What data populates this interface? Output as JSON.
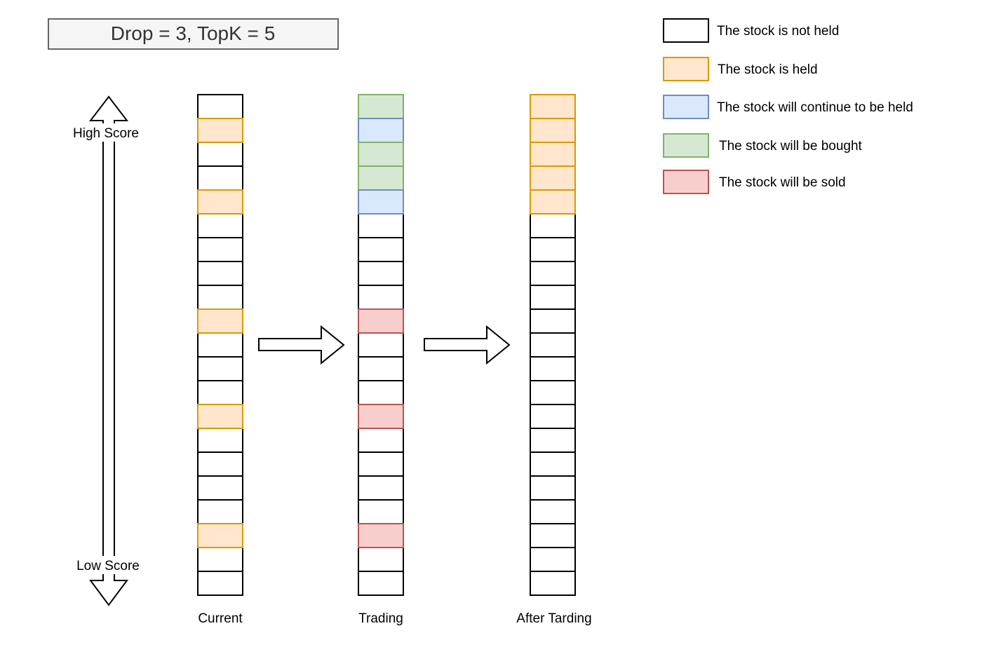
{
  "header": {
    "title": "Drop = 3, TopK = 5"
  },
  "score_axis": {
    "high_label": "High Score",
    "low_label": "Low Score"
  },
  "colors": {
    "empty": {
      "fill": "#ffffff",
      "stroke": "#000000"
    },
    "held": {
      "fill": "#ffe6cc",
      "stroke": "#d79b00"
    },
    "continue": {
      "fill": "#dae8fc",
      "stroke": "#6c8ebf"
    },
    "buy": {
      "fill": "#d5e8d4",
      "stroke": "#82b366"
    },
    "sell": {
      "fill": "#f8cecc",
      "stroke": "#b85450"
    }
  },
  "legend": [
    {
      "state": "empty",
      "label": "The stock is not held"
    },
    {
      "state": "held",
      "label": "The stock is held"
    },
    {
      "state": "continue",
      "label": "The stock will continue to be held"
    },
    {
      "state": "buy",
      "label": "The stock will be bought"
    },
    {
      "state": "sell",
      "label": "The stock will be sold"
    }
  ],
  "columns": [
    {
      "id": "current",
      "label": "Current",
      "cells": [
        "empty",
        "held",
        "empty",
        "empty",
        "held",
        "empty",
        "empty",
        "empty",
        "empty",
        "held",
        "empty",
        "empty",
        "empty",
        "held",
        "empty",
        "empty",
        "empty",
        "empty",
        "held",
        "empty",
        "empty"
      ]
    },
    {
      "id": "trading",
      "label": "Trading",
      "cells": [
        "buy",
        "continue",
        "buy",
        "buy",
        "continue",
        "empty",
        "empty",
        "empty",
        "empty",
        "sell",
        "empty",
        "empty",
        "empty",
        "sell",
        "empty",
        "empty",
        "empty",
        "empty",
        "sell",
        "empty",
        "empty"
      ]
    },
    {
      "id": "after-trading",
      "label": "After Tarding",
      "cells": [
        "held",
        "held",
        "held",
        "held",
        "held",
        "empty",
        "empty",
        "empty",
        "empty",
        "empty",
        "empty",
        "empty",
        "empty",
        "empty",
        "empty",
        "empty",
        "empty",
        "empty",
        "empty",
        "empty",
        "empty"
      ]
    }
  ]
}
